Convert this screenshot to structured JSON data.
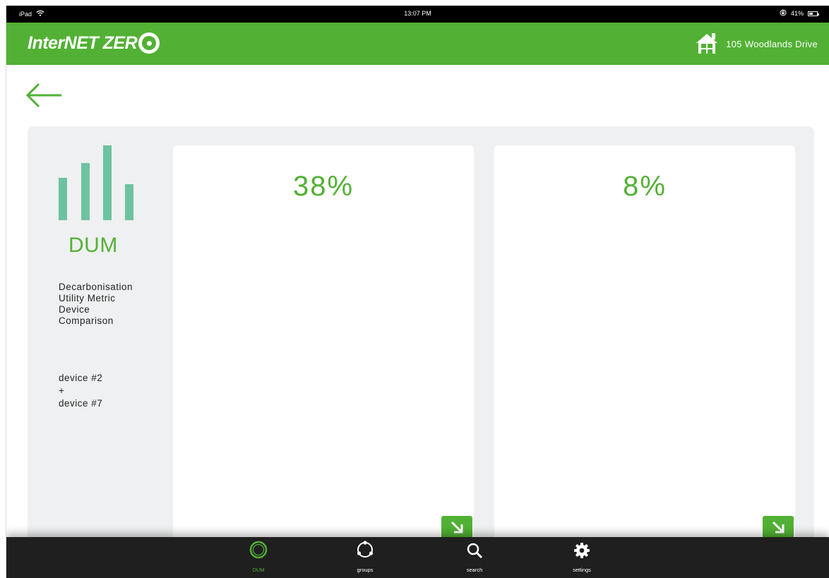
{
  "status_bar": {
    "carrier": "iPad",
    "time": "13:07 PM",
    "battery": "41%",
    "battery_level": 0.41
  },
  "header": {
    "logo_text": "InterNET ZER",
    "address": "105 Woodlands Drive",
    "brand_color": "#52b134"
  },
  "back_icon": "arrow-left-icon",
  "sidebar": {
    "title": "DUM",
    "description_lines": [
      "Decarbonisation",
      "Utility Metric",
      "Device",
      "Comparison"
    ],
    "device_lines": [
      "device #2",
      "+",
      "device #7"
    ],
    "bar_icon_color": "#6dc3a0"
  },
  "cards": [
    {
      "percent": "38%",
      "expand_icon": "expand-arrow-icon"
    },
    {
      "percent": "8%",
      "expand_icon": "expand-arrow-icon"
    }
  ],
  "tabs": [
    {
      "label": "DUM",
      "icon": "ring-icon",
      "active": true
    },
    {
      "label": "groups",
      "icon": "groups-icon",
      "active": false
    },
    {
      "label": "search",
      "icon": "search-icon",
      "active": false
    },
    {
      "label": "settings",
      "icon": "gear-icon",
      "active": false
    }
  ]
}
